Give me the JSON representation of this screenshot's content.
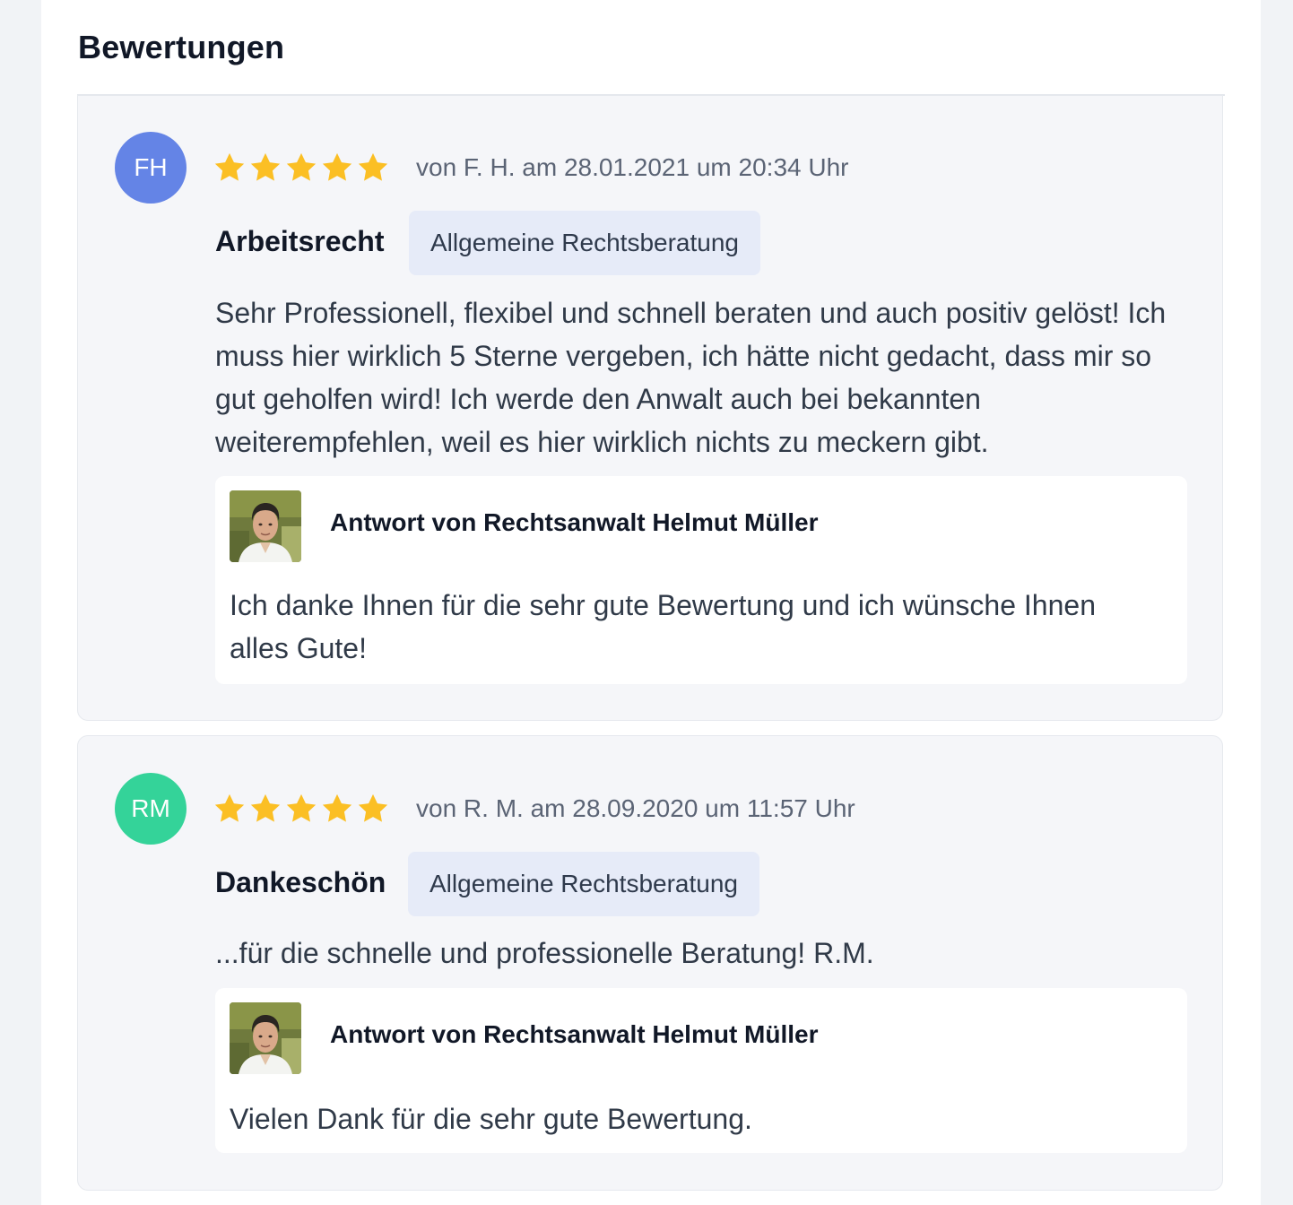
{
  "section": {
    "title": "Bewertungen"
  },
  "colors": {
    "star": "#fbbf24",
    "avatar_fh": "#6484e6",
    "avatar_rm": "#34d399",
    "tag_bg": "#e6ebf8",
    "card_bg": "#f5f6f9"
  },
  "reviews": [
    {
      "initials": "FH",
      "rating": 5,
      "meta": "von F. H. am 28.01.2021 um 20:34 Uhr",
      "title": "Arbeitsrecht",
      "tag": "Allgemeine Rechtsberatung",
      "text": "Sehr Professionell, flexibel und schnell beraten und auch positiv gelöst! Ich muss hier wirklich 5 Sterne vergeben, ich hätte nicht gedacht, dass mir so gut geholfen wird! Ich werde den Anwalt auch bei bekannten weiterempfehlen, weil es hier wirklich nichts zu meckern gibt.",
      "reply": {
        "author": "Antwort von Rechtsanwalt Helmut Müller",
        "text": "Ich danke Ihnen für die sehr gute Bewertung und ich wünsche Ihnen alles Gute!"
      }
    },
    {
      "initials": "RM",
      "rating": 5,
      "meta": "von R. M. am 28.09.2020 um 11:57 Uhr",
      "title": "Dankeschön",
      "tag": "Allgemeine Rechtsberatung",
      "text": "...für die schnelle und professionelle Beratung! R.M.",
      "reply": {
        "author": "Antwort von Rechtsanwalt Helmut Müller",
        "text": "Vielen Dank für die sehr gute Bewertung."
      }
    }
  ]
}
